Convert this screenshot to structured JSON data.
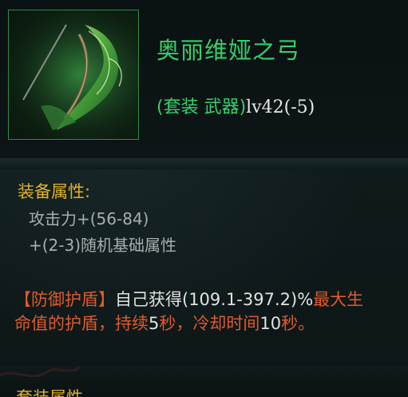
{
  "item": {
    "name": "奥丽维娅之弓",
    "type_label": "(套装 武器)",
    "level": "lv42(-5)",
    "icon": "green-bow-icon"
  },
  "attributes": {
    "title": "装备属性:",
    "stat1": "攻击力+(56-84)",
    "stat2": "+(2-3)随机基础属性"
  },
  "effect": {
    "part1": "【防御护盾】",
    "part2": "自己获得",
    "part3": "(109.1-397.2)%",
    "part4": "最大生命值的护盾，持续",
    "part5": "5",
    "part6": "秒，冷却时间",
    "part7": "10",
    "part8": "秒。"
  },
  "set_section": {
    "title": "套装属性"
  },
  "colors": {
    "rarity_green": "#35d06a",
    "section_gold": "#e0b22a",
    "effect_orange": "#e05a2a",
    "stat_gray": "#a9adad"
  }
}
